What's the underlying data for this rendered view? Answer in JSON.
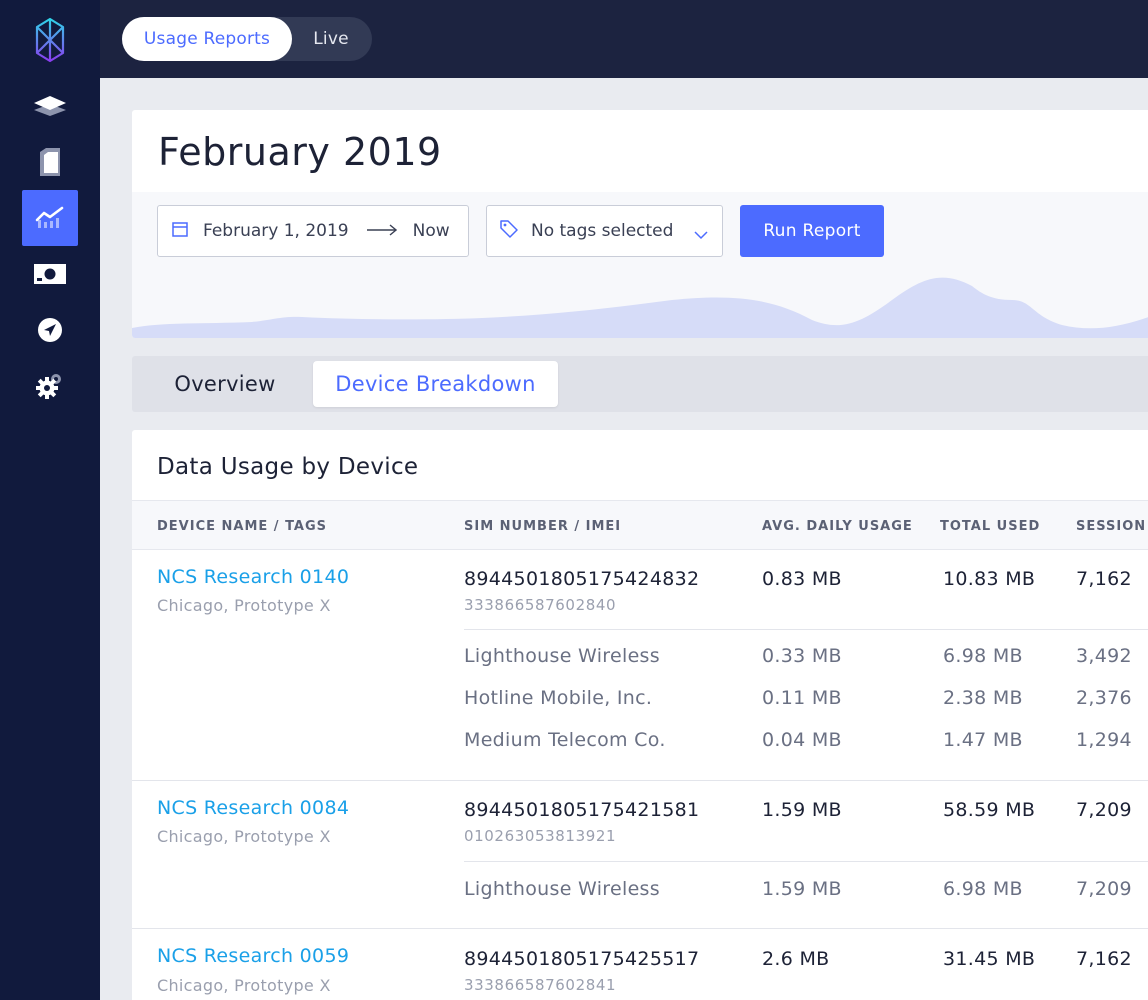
{
  "nav": {
    "items": [
      {
        "id": "devices",
        "icon": "layers-icon",
        "active": false
      },
      {
        "id": "sims",
        "icon": "sim-card-icon",
        "active": false
      },
      {
        "id": "usage",
        "icon": "chart-icon",
        "active": true
      },
      {
        "id": "billing",
        "icon": "money-icon",
        "active": false
      },
      {
        "id": "routes",
        "icon": "navigation-icon",
        "active": false
      },
      {
        "id": "settings",
        "icon": "gear-icon",
        "active": false
      }
    ]
  },
  "topbar": {
    "segments": [
      {
        "label": "Usage Reports",
        "active": true
      },
      {
        "label": "Live",
        "active": false
      }
    ]
  },
  "report": {
    "title": "February 2019",
    "date_start": "February 1, 2019",
    "date_end": "Now",
    "tags_placeholder": "No tags selected",
    "run_label": "Run Report"
  },
  "tabs": {
    "overview": "Overview",
    "breakdown": "Device Breakdown",
    "active": "breakdown"
  },
  "table": {
    "title": "Data Usage by Device",
    "columns": [
      "DEVICE NAME / TAGS",
      "SIM NUMBER / IMEI",
      "AVG. DAILY USAGE",
      "TOTAL USED",
      "SESSION"
    ],
    "devices": [
      {
        "name": "NCS Research 0140",
        "tags": "Chicago, Prototype X",
        "sim": "8944501805175424832",
        "imei": "333866587602840",
        "avg": "0.83 MB",
        "total": "10.83 MB",
        "sessions": "7,162",
        "carriers": [
          {
            "name": "Lighthouse Wireless",
            "avg": "0.33 MB",
            "total": "6.98 MB",
            "sessions": "3,492"
          },
          {
            "name": "Hotline Mobile, Inc.",
            "avg": "0.11 MB",
            "total": "2.38 MB",
            "sessions": "2,376"
          },
          {
            "name": "Medium Telecom Co.",
            "avg": "0.04 MB",
            "total": "1.47 MB",
            "sessions": "1,294"
          }
        ]
      },
      {
        "name": "NCS Research 0084",
        "tags": "Chicago, Prototype X",
        "sim": "8944501805175421581",
        "imei": "010263053813921",
        "avg": "1.59 MB",
        "total": "58.59 MB",
        "sessions": "7,209",
        "carriers": [
          {
            "name": "Lighthouse Wireless",
            "avg": "1.59 MB",
            "total": "6.98 MB",
            "sessions": "7,209"
          }
        ]
      },
      {
        "name": "NCS Research 0059",
        "tags": "Chicago, Prototype X",
        "sim": "8944501805175425517",
        "imei": "333866587602841",
        "avg": "2.6 MB",
        "total": "31.45 MB",
        "sessions": "7,162",
        "carriers": []
      }
    ]
  },
  "colors": {
    "accent": "#4c6bff",
    "sidebar": "#111a3d",
    "link": "#1aa0e8",
    "sparkline": "#d6dcf8"
  }
}
